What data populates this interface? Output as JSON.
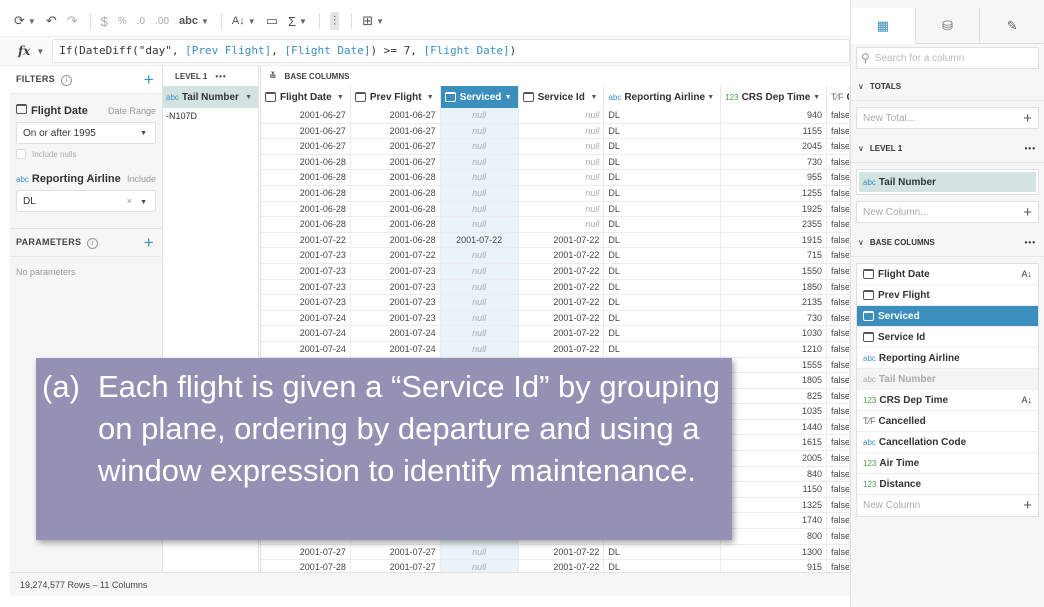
{
  "toolbar": {
    "items": [
      "refresh-icon",
      "undo-icon",
      "redo-icon",
      "$",
      "%",
      ".0",
      ".00",
      "abc"
    ],
    "currency_label": "$",
    "percent_label": "%",
    "decrease_decimals_label": ".0",
    "increase_decimals_label": ".00",
    "format_label": "abc",
    "sort_label": "A↓Z",
    "comment_label": "🗩",
    "sum_label": "Σ"
  },
  "formula": {
    "fx_label": "fx",
    "parts": [
      {
        "text": "If(DateDiff(\"day\", ",
        "ref": false
      },
      {
        "text": "[Prev Flight]",
        "ref": true
      },
      {
        "text": ", ",
        "ref": false
      },
      {
        "text": "[Flight Date]",
        "ref": true
      },
      {
        "text": ") >= 7, ",
        "ref": false
      },
      {
        "text": "[Flight Date]",
        "ref": true
      },
      {
        "text": ")",
        "ref": false
      }
    ]
  },
  "filters": {
    "title": "FILTERS",
    "flight_date": {
      "label": "Flight Date",
      "kind": "Date Range",
      "value": "On or after 1995",
      "include_nulls_label": "Include nulls",
      "include_nulls": false
    },
    "airline": {
      "type": "abc",
      "label": "Reporting Airline",
      "kind": "Include",
      "value": "DL"
    }
  },
  "parameters": {
    "title": "PARAMETERS",
    "empty_text": "No parameters"
  },
  "level1": {
    "title": "LEVEL 1",
    "column": {
      "type": "abc",
      "label": "Tail Number"
    },
    "value": "-N107D"
  },
  "grid": {
    "title": "BASE COLUMNS",
    "columns": [
      {
        "label": "Flight Date",
        "type": "date"
      },
      {
        "label": "Prev Flight",
        "type": "date"
      },
      {
        "label": "Serviced",
        "type": "date",
        "selected": true
      },
      {
        "label": "Service Id",
        "type": "date"
      },
      {
        "label": "Reporting Airline",
        "type": "abc"
      },
      {
        "label": "CRS Dep Time",
        "type": "123"
      },
      {
        "label": "C",
        "type": "bool"
      }
    ],
    "rows": [
      [
        "2001-06-27",
        "2001-06-27",
        "null",
        "null",
        "DL",
        "940",
        "false"
      ],
      [
        "2001-06-27",
        "2001-06-27",
        "null",
        "null",
        "DL",
        "1155",
        "false"
      ],
      [
        "2001-06-27",
        "2001-06-27",
        "null",
        "null",
        "DL",
        "2045",
        "false"
      ],
      [
        "2001-06-28",
        "2001-06-27",
        "null",
        "null",
        "DL",
        "730",
        "false"
      ],
      [
        "2001-06-28",
        "2001-06-28",
        "null",
        "null",
        "DL",
        "955",
        "false"
      ],
      [
        "2001-06-28",
        "2001-06-28",
        "null",
        "null",
        "DL",
        "1255",
        "false"
      ],
      [
        "2001-06-28",
        "2001-06-28",
        "null",
        "null",
        "DL",
        "1925",
        "false"
      ],
      [
        "2001-06-28",
        "2001-06-28",
        "null",
        "null",
        "DL",
        "2355",
        "false"
      ],
      [
        "2001-07-22",
        "2001-06-28",
        "2001-07-22",
        "2001-07-22",
        "DL",
        "1915",
        "false"
      ],
      [
        "2001-07-23",
        "2001-07-22",
        "null",
        "2001-07-22",
        "DL",
        "715",
        "false"
      ],
      [
        "2001-07-23",
        "2001-07-23",
        "null",
        "2001-07-22",
        "DL",
        "1550",
        "false"
      ],
      [
        "2001-07-23",
        "2001-07-23",
        "null",
        "2001-07-22",
        "DL",
        "1850",
        "false"
      ],
      [
        "2001-07-23",
        "2001-07-23",
        "null",
        "2001-07-22",
        "DL",
        "2135",
        "false"
      ],
      [
        "2001-07-24",
        "2001-07-23",
        "null",
        "2001-07-22",
        "DL",
        "730",
        "false"
      ],
      [
        "2001-07-24",
        "2001-07-24",
        "null",
        "2001-07-22",
        "DL",
        "1030",
        "false"
      ],
      [
        "2001-07-24",
        "2001-07-24",
        "null",
        "2001-07-22",
        "DL",
        "1210",
        "false"
      ],
      [
        "2001-07-24",
        "2001-07-24",
        "null",
        "2001-07-22",
        "DL",
        "1555",
        "false"
      ],
      [
        "",
        "",
        "",
        "",
        "",
        "1805",
        "false"
      ],
      [
        "",
        "",
        "",
        "",
        "",
        "825",
        "false"
      ],
      [
        "",
        "",
        "",
        "",
        "",
        "1035",
        "false"
      ],
      [
        "",
        "",
        "",
        "",
        "",
        "1440",
        "false"
      ],
      [
        "",
        "",
        "",
        "",
        "",
        "1615",
        "false"
      ],
      [
        "",
        "",
        "",
        "",
        "",
        "2005",
        "false"
      ],
      [
        "",
        "",
        "",
        "",
        "",
        "840",
        "false"
      ],
      [
        "",
        "",
        "",
        "",
        "",
        "1150",
        "false"
      ],
      [
        "",
        "",
        "",
        "",
        "",
        "1325",
        "false"
      ],
      [
        "",
        "",
        "",
        "",
        "",
        "1740",
        "false"
      ],
      [
        "",
        "",
        "",
        "",
        "",
        "800",
        "false"
      ],
      [
        "2001-07-27",
        "2001-07-27",
        "null",
        "2001-07-22",
        "DL",
        "1300",
        "false"
      ],
      [
        "2001-07-28",
        "2001-07-27",
        "null",
        "2001-07-22",
        "DL",
        "915",
        "false"
      ]
    ]
  },
  "footer": {
    "status": "19,274,577 Rows – 11 Columns"
  },
  "right_panel": {
    "search_placeholder": "Search for a column",
    "totals_title": "TOTALS",
    "new_total": "New Total...",
    "level1_title": "LEVEL 1",
    "level1_column": {
      "type": "abc",
      "label": "Tail Number"
    },
    "new_column_level": "New Column...",
    "base_title": "BASE COLUMNS",
    "base_columns": [
      {
        "type": "date",
        "label": "Flight Date",
        "sorted": true
      },
      {
        "type": "date",
        "label": "Prev Flight"
      },
      {
        "type": "date",
        "label": "Serviced",
        "selected": true
      },
      {
        "type": "date",
        "label": "Service Id"
      },
      {
        "type": "abc",
        "label": "Reporting Airline"
      },
      {
        "type": "abc",
        "label": "Tail Number",
        "dimmed": true
      },
      {
        "type": "123",
        "label": "CRS Dep Time",
        "sorted": true
      },
      {
        "type": "bool",
        "label": "Cancelled"
      },
      {
        "type": "abc",
        "label": "Cancellation Code"
      },
      {
        "type": "123",
        "label": "Air Time"
      },
      {
        "type": "123",
        "label": "Distance"
      }
    ],
    "new_column_base": "New Column"
  },
  "caption": {
    "label": "(a)",
    "text": "Each flight is given a “Service Id” by grouping on plane, ordering by departure and using a window expression to identify maintenance."
  }
}
